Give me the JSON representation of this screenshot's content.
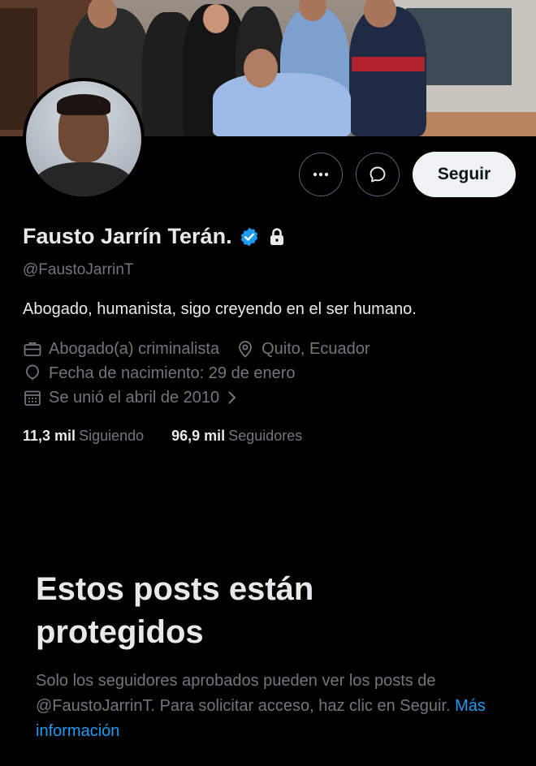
{
  "profile": {
    "name": "Fausto Jarrín Terán.",
    "handle": "@FaustoJarrinT",
    "bio": "Abogado, humanista, sigo creyendo en el ser humano.",
    "profession": "Abogado(a) criminalista",
    "location": "Quito, Ecuador",
    "birthday": "Fecha de nacimiento: 29 de enero",
    "joined": "Se unió el abril de 2010",
    "verified_color": "#1d9bf0"
  },
  "actions": {
    "follow_label": "Seguir",
    "more_icon": "more-icon",
    "message_icon": "message-icon"
  },
  "stats": {
    "following_count": "11,3 mil",
    "following_label": "Siguiendo",
    "followers_count": "96,9 mil",
    "followers_label": "Seguidores"
  },
  "protected": {
    "title": "Estos posts están protegidos",
    "text": "Solo los seguidores aprobados pueden ver los posts de @FaustoJarrinT. Para solicitar acceso, haz clic en Seguir.",
    "link": "Más información"
  }
}
